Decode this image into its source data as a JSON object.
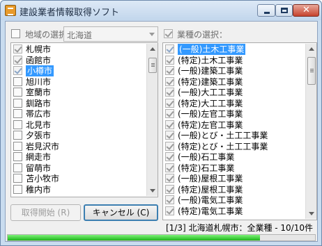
{
  "window": {
    "title": "建設業者情報取得ソフト"
  },
  "region": {
    "label": "地域の選択：",
    "selected": "北海道",
    "items": [
      {
        "label": "札幌市",
        "checked": true,
        "selected": false
      },
      {
        "label": "函館市",
        "checked": true,
        "selected": false
      },
      {
        "label": "小樽市",
        "checked": true,
        "selected": true
      },
      {
        "label": "旭川市",
        "checked": false,
        "selected": false
      },
      {
        "label": "室蘭市",
        "checked": false,
        "selected": false
      },
      {
        "label": "釧路市",
        "checked": false,
        "selected": false
      },
      {
        "label": "帯広市",
        "checked": false,
        "selected": false
      },
      {
        "label": "北見市",
        "checked": false,
        "selected": false
      },
      {
        "label": "夕張市",
        "checked": false,
        "selected": false
      },
      {
        "label": "岩見沢市",
        "checked": false,
        "selected": false
      },
      {
        "label": "網走市",
        "checked": false,
        "selected": false
      },
      {
        "label": "留萌市",
        "checked": false,
        "selected": false
      },
      {
        "label": "苫小牧市",
        "checked": false,
        "selected": false
      },
      {
        "label": "稚内市",
        "checked": false,
        "selected": false
      }
    ]
  },
  "industry": {
    "label": "業種の選択：",
    "items": [
      {
        "label": "(一般)土木工事業",
        "checked": true,
        "selected": true
      },
      {
        "label": "(特定)土木工事業",
        "checked": true,
        "selected": false
      },
      {
        "label": "(一般)建築工事業",
        "checked": true,
        "selected": false
      },
      {
        "label": "(特定)建築工事業",
        "checked": true,
        "selected": false
      },
      {
        "label": "(一般)大工工事業",
        "checked": true,
        "selected": false
      },
      {
        "label": "(特定)大工工事業",
        "checked": true,
        "selected": false
      },
      {
        "label": "(一般)左官工事業",
        "checked": true,
        "selected": false
      },
      {
        "label": "(特定)左官工事業",
        "checked": true,
        "selected": false
      },
      {
        "label": "(一般)とび・土工工事業",
        "checked": true,
        "selected": false
      },
      {
        "label": "(特定)とび・土工工事業",
        "checked": true,
        "selected": false
      },
      {
        "label": "(一般)石工事業",
        "checked": true,
        "selected": false
      },
      {
        "label": "(特定)石工事業",
        "checked": true,
        "selected": false
      },
      {
        "label": "(一般)屋根工事業",
        "checked": true,
        "selected": false
      },
      {
        "label": "(特定)屋根工事業",
        "checked": true,
        "selected": false
      },
      {
        "label": "(一般)電気工事業",
        "checked": true,
        "selected": false
      },
      {
        "label": "(特定)電気工事業",
        "checked": true,
        "selected": false
      }
    ]
  },
  "buttons": {
    "start": "取得開始 (R)",
    "cancel": "キャンセル (C)"
  },
  "status": {
    "text": "[1/3] 北海道札幌市：全業種 - 10/10件",
    "progress": 0.82
  },
  "colors": {
    "selection": "#3399ff",
    "progress": "#1db51a"
  }
}
